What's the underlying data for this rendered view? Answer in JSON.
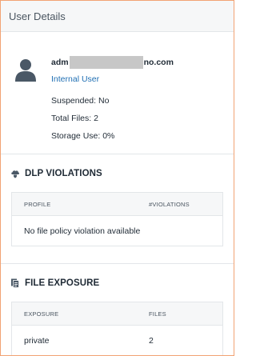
{
  "panel": {
    "title": "User Details"
  },
  "user": {
    "email_prefix": "adm",
    "email_suffix": "no.com",
    "role": "Internal User",
    "suspended_label": "Suspended:",
    "suspended_value": "No",
    "total_files_label": "Total Files:",
    "total_files_value": "2",
    "storage_label": "Storage Use:",
    "storage_value": "0%"
  },
  "dlp": {
    "title": "DLP VIOLATIONS",
    "icon": "shield-cloud-icon",
    "columns": [
      "PROFILE",
      "#VIOLATIONS"
    ],
    "empty_message": "No file policy violation available"
  },
  "exposure": {
    "title": "FILE EXPOSURE",
    "icon": "document-stack-icon",
    "columns": [
      "EXPOSURE",
      "FILES"
    ],
    "rows": [
      {
        "exposure": "private",
        "files": "2"
      }
    ]
  },
  "colors": {
    "frame_border": "#f2a374",
    "link_blue": "#1f6fb3",
    "header_bg": "#f6f7f8",
    "icon_gray": "#4a5866"
  }
}
